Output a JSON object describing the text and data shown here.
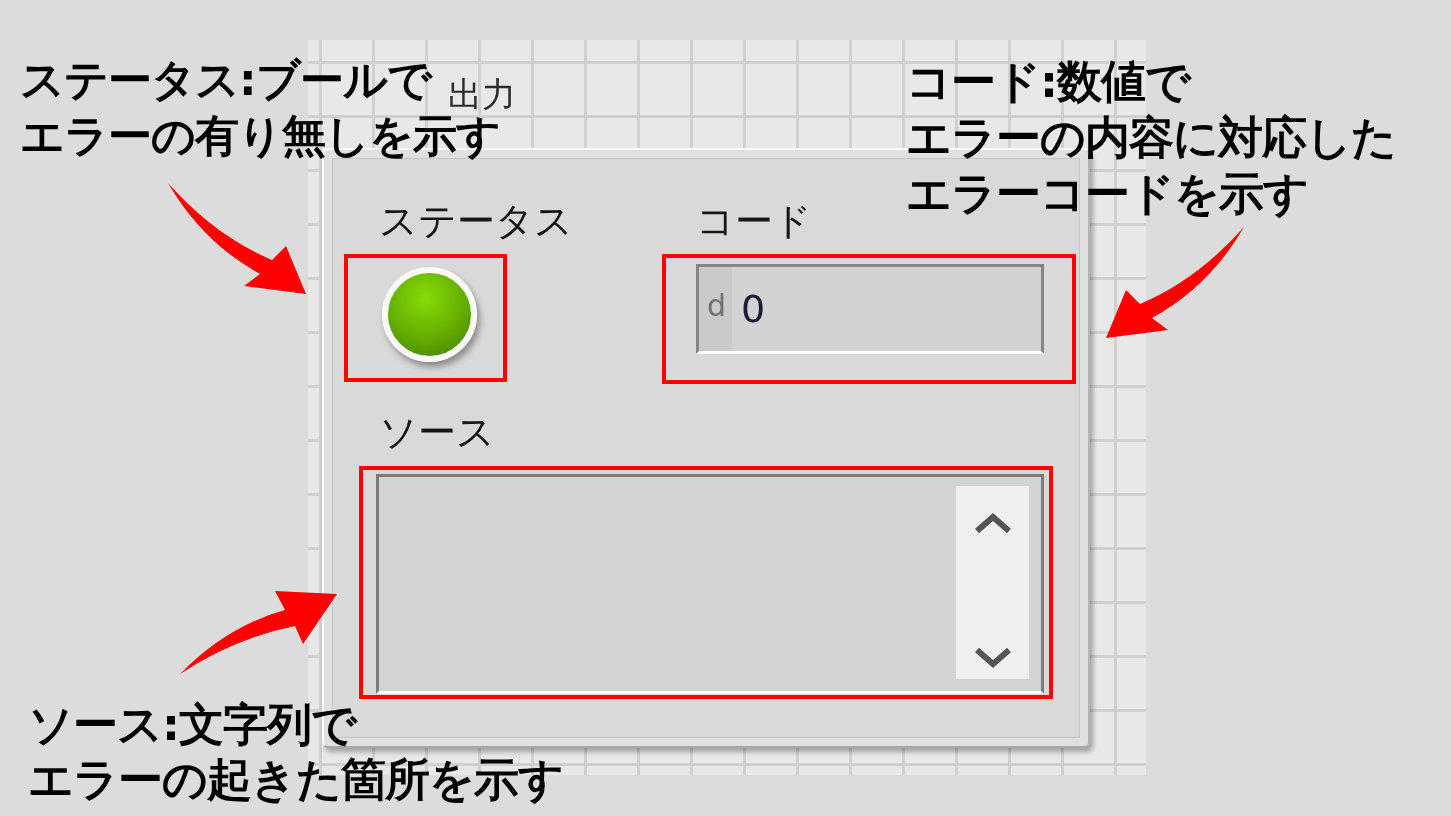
{
  "annotations": [
    {
      "kind": "status",
      "lines": [
        "ステータス:ブールで",
        "エラーの有り無しを示す"
      ]
    },
    {
      "kind": "code",
      "lines": [
        "コード:数値で",
        "エラーの内容に対応した",
        "エラーコードを示す"
      ]
    },
    {
      "kind": "source",
      "lines": [
        "ソース:文字列で",
        "エラーの起きた箇所を示す"
      ]
    }
  ],
  "cluster": {
    "title": "出力",
    "status": {
      "label": "ステータス",
      "value": false,
      "highlighted": true
    },
    "code": {
      "label": "コード",
      "radix": "d",
      "value": "0",
      "highlighted": true
    },
    "source": {
      "label": "ソース",
      "highlighted": true
    }
  }
}
